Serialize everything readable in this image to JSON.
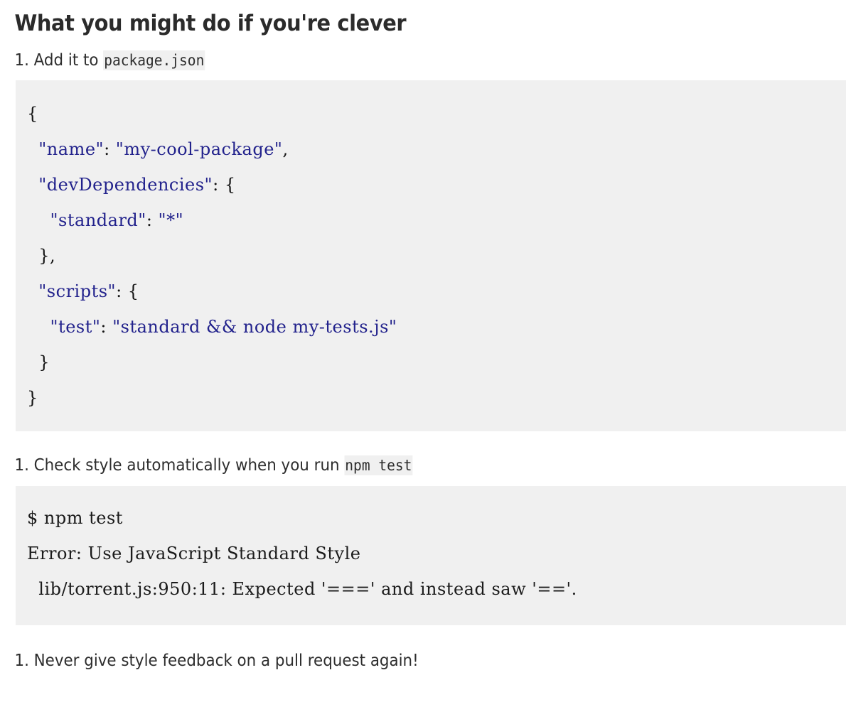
{
  "document": {
    "heading": "What you might do if you're clever",
    "steps": [
      {
        "marker": "1.",
        "text_before": " Add it to ",
        "inline_code": "package.json",
        "text_after": ""
      },
      {
        "marker": "1.",
        "text_before": " Check style automatically when you run ",
        "inline_code": "npm test",
        "text_after": ""
      },
      {
        "marker": "1.",
        "text_before": " Never give style feedback on a pull request again!",
        "inline_code": "",
        "text_after": ""
      }
    ],
    "code_blocks": {
      "package_json": {
        "language": "json",
        "lines": [
          {
            "indent": "",
            "segments": [
              {
                "text": "{",
                "type": "punc"
              }
            ]
          },
          {
            "indent": "  ",
            "segments": [
              {
                "text": "\"name\"",
                "type": "str"
              },
              {
                "text": ": ",
                "type": "punc"
              },
              {
                "text": "\"my-cool-package\"",
                "type": "str"
              },
              {
                "text": ",",
                "type": "punc"
              }
            ]
          },
          {
            "indent": "  ",
            "segments": [
              {
                "text": "\"devDependencies\"",
                "type": "str"
              },
              {
                "text": ": {",
                "type": "punc"
              }
            ]
          },
          {
            "indent": "    ",
            "segments": [
              {
                "text": "\"standard\"",
                "type": "str"
              },
              {
                "text": ": ",
                "type": "punc"
              },
              {
                "text": "\"*\"",
                "type": "str"
              }
            ]
          },
          {
            "indent": "  ",
            "segments": [
              {
                "text": "},",
                "type": "punc"
              }
            ]
          },
          {
            "indent": "  ",
            "segments": [
              {
                "text": "\"scripts\"",
                "type": "str"
              },
              {
                "text": ": {",
                "type": "punc"
              }
            ]
          },
          {
            "indent": "    ",
            "segments": [
              {
                "text": "\"test\"",
                "type": "str"
              },
              {
                "text": ": ",
                "type": "punc"
              },
              {
                "text": "\"standard && node my-tests.js\"",
                "type": "str"
              }
            ]
          },
          {
            "indent": "  ",
            "segments": [
              {
                "text": "}",
                "type": "punc"
              }
            ]
          },
          {
            "indent": "",
            "segments": [
              {
                "text": "}",
                "type": "punc"
              }
            ]
          }
        ]
      },
      "npm_test_output": {
        "language": "shell",
        "lines": [
          {
            "indent": "",
            "segments": [
              {
                "text": "$ npm test",
                "type": "plain"
              }
            ]
          },
          {
            "indent": "",
            "segments": [
              {
                "text": "Error: Use JavaScript Standard Style",
                "type": "plain"
              }
            ]
          },
          {
            "indent": "  ",
            "segments": [
              {
                "text": "lib/torrent.js:950:11: Expected '===' and instead saw '=='.",
                "type": "plain"
              }
            ]
          }
        ]
      }
    }
  },
  "colors": {
    "page_background": "#ffffff",
    "body_text": "#2d2d2d",
    "heading_text": "#2b2b2b",
    "code_background": "#f0f0f0",
    "code_string": "#22228c",
    "code_punctuation": "#141414",
    "code_plain": "#1b1b1b",
    "inline_code_background": "#f0f0f0"
  }
}
